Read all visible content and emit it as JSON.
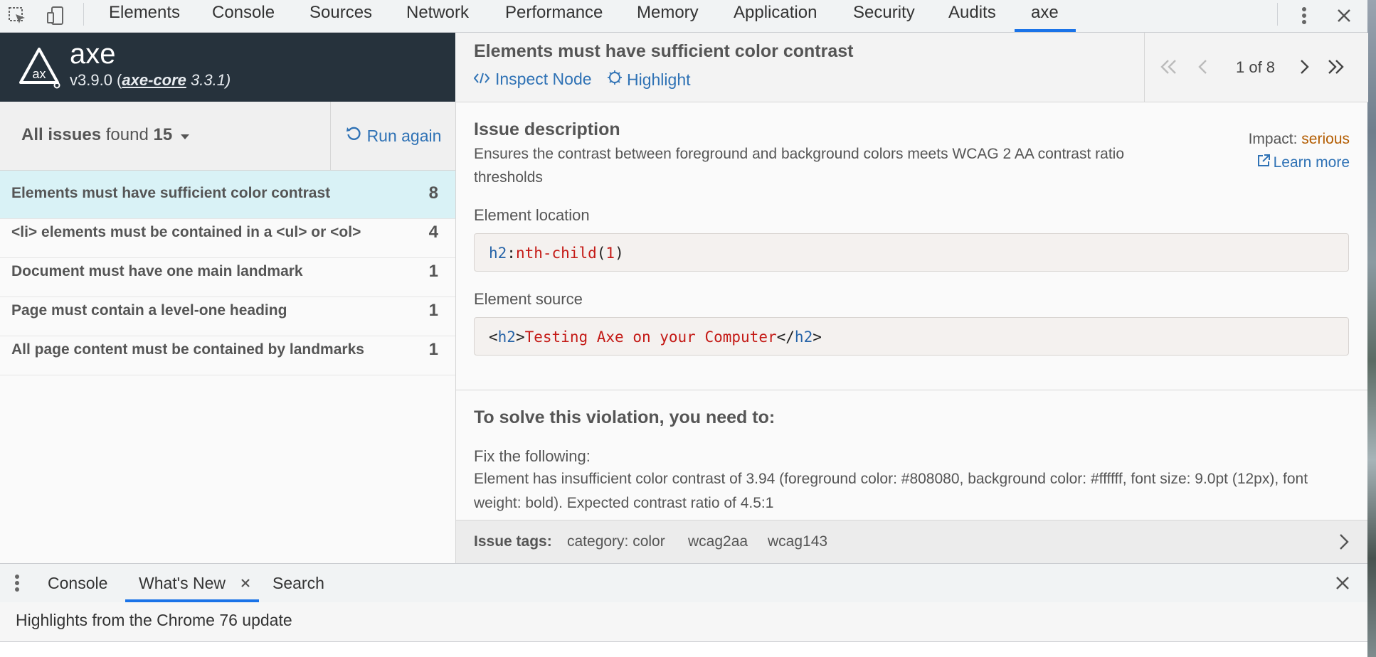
{
  "devtools": {
    "tabs": [
      "Elements",
      "Console",
      "Sources",
      "Network",
      "Performance",
      "Memory",
      "Application",
      "Security",
      "Audits",
      "axe"
    ],
    "active_tab": "axe"
  },
  "axe": {
    "title": "axe",
    "version_prefix": "v3.9.0 (",
    "core_name": "axe-core",
    "core_version": " 3.3.1)"
  },
  "issues": {
    "filter_prefix": "All issues",
    "filter_found": " found ",
    "total": "15",
    "run_again": "Run again",
    "list": [
      {
        "name": "Elements must have sufficient color contrast",
        "count": "8"
      },
      {
        "name": "<li> elements must be contained in a <ul> or <ol>",
        "count": "4"
      },
      {
        "name": "Document must have one main landmark",
        "count": "1"
      },
      {
        "name": "Page must contain a level-one heading",
        "count": "1"
      },
      {
        "name": "All page content must be contained by landmarks",
        "count": "1"
      }
    ]
  },
  "detail": {
    "rule_title": "Elements must have sufficient color contrast",
    "inspect_node": "Inspect Node",
    "highlight": "Highlight",
    "pager_label": "1 of 8",
    "desc_heading": "Issue description",
    "desc_text": "Ensures the contrast between foreground and background colors meets WCAG 2 AA contrast ratio thresholds",
    "impact_label": "Impact: ",
    "impact_value": "serious",
    "learn_more": "Learn more",
    "location_label": "Element location",
    "location_tag": "h2",
    "location_colon": ":",
    "location_pseudo": "nth-child",
    "location_open": "(",
    "location_num": "1",
    "location_close": ")",
    "source_label": "Element source",
    "source_lt": "<",
    "source_tag": "h2",
    "source_gt": ">",
    "source_text": "Testing Axe on your Computer",
    "source_close_lt": "</",
    "source_close_tag": "h2",
    "source_close_gt": ">",
    "solve_heading": "To solve this violation, you need to:",
    "fix_label": "Fix the following:",
    "fix_text": "Element has insufficient color contrast of 3.94 (foreground color: #808080, background color: #ffffff, font size: 9.0pt (12px), font weight: bold). Expected contrast ratio of 4.5:1",
    "tags_label": "Issue tags:",
    "tags": [
      "category: color",
      "wcag2aa",
      "wcag143"
    ]
  },
  "drawer": {
    "tabs": [
      "Console",
      "What's New",
      "Search"
    ],
    "active_tab": "What's New",
    "content": "Highlights from the Chrome 76 update"
  },
  "colors": {
    "accent_blue": "#1a73e8",
    "link_blue": "#2f72b5",
    "axe_header_bg": "#26323c",
    "selected_row_bg": "#d9f2f6",
    "impact_serious": "#b35c00"
  }
}
